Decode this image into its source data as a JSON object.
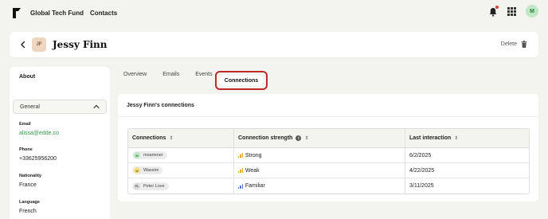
{
  "topbar": {
    "brand": "Global Tech Fund",
    "section": "Contacts",
    "avatar_initial": "M",
    "icons": [
      "logo-icon",
      "bell-icon",
      "apps-grid-icon"
    ]
  },
  "header": {
    "initials": "JF",
    "name": "Jessy Finn",
    "delete_label": "Delete"
  },
  "sidebar": {
    "about_label": "About",
    "general_label": "General",
    "fields": [
      {
        "label": "Email",
        "value": "alissa@edde.co"
      },
      {
        "label": "Phone",
        "value": "+33625956200"
      },
      {
        "label": "Nationality",
        "value": "France"
      },
      {
        "label": "Language",
        "value": "French"
      }
    ]
  },
  "tabs": [
    "Overview",
    "Emails",
    "Events",
    "Connections"
  ],
  "active_tab": "Connections",
  "connections": {
    "title": "Jessy Finn's connections",
    "columns": [
      "Connections",
      "Connection strength",
      "Last interaction"
    ],
    "rows": [
      {
        "initial": "M",
        "name": "moammer",
        "avatar_bg": "#bfe8c6",
        "avatar_fg": "#2a7d3a",
        "strength": "Strong",
        "strength_color": "#e0a82e",
        "date": "6/2/2025"
      },
      {
        "initial": "W",
        "name": "Wassim",
        "avatar_bg": "#f7e08a",
        "avatar_fg": "#8a6a10",
        "strength": "Weak",
        "strength_color": "#e0a82e",
        "date": "4/22/2025"
      },
      {
        "initial": "PL",
        "name": "Peter Love",
        "avatar_bg": "#d9d9d9",
        "avatar_fg": "#555555",
        "strength": "Familiar",
        "strength_color": "#5b7fd9",
        "date": "3/11/2025"
      }
    ]
  },
  "colors": {
    "accent_green": "#2e9b47",
    "highlight_red": "#c0282b",
    "notification_dot": "#e04040"
  }
}
